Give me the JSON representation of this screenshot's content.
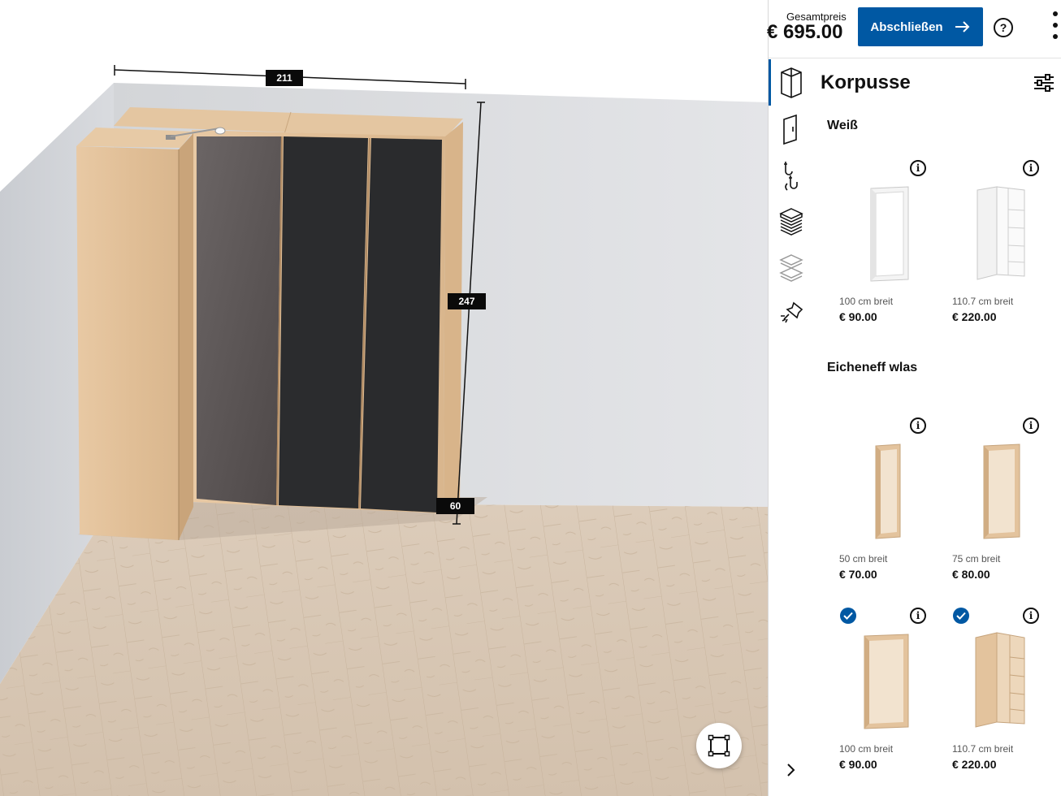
{
  "viewport": {
    "dimensions": {
      "width": "211",
      "height": "247",
      "depth": "60"
    }
  },
  "header": {
    "total_label": "Gesamtpreis",
    "total_price": "€ 695.00",
    "finish_label": "Abschließen",
    "help_icon": "question-circle-icon",
    "more_icon": "more-vertical-icon"
  },
  "nav": {
    "items": [
      {
        "icon": "cabinet-frame-icon",
        "active": true
      },
      {
        "icon": "door-icon",
        "active": false
      },
      {
        "icon": "handle-icon",
        "active": false
      },
      {
        "icon": "shelves-icon",
        "active": false
      },
      {
        "icon": "baskets-icon",
        "active": false
      },
      {
        "icon": "lamp-icon",
        "active": false
      }
    ]
  },
  "section": {
    "title": "Korpusse",
    "filter_icon": "sliders-icon"
  },
  "groups": [
    {
      "title": "Weiß",
      "items": [
        {
          "width": "100 cm breit",
          "price": "€ 90.00",
          "selected": false
        },
        {
          "width": "110.7 cm breit",
          "price": "€ 220.00",
          "selected": false
        }
      ]
    },
    {
      "title": "Eicheneff wlas",
      "items": [
        {
          "width": "50 cm breit",
          "price": "€ 70.00",
          "selected": false
        },
        {
          "width": "75 cm breit",
          "price": "€ 80.00",
          "selected": false
        },
        {
          "width": "100 cm breit",
          "price": "€ 90.00",
          "selected": true
        },
        {
          "width": "110.7 cm breit",
          "price": "€ 220.00",
          "selected": true
        }
      ]
    }
  ],
  "colors": {
    "accent": "#0058a3",
    "oak": "#e3c39d",
    "white_frame": "#f4f4f4",
    "dark_glass": "#2a2b2d"
  }
}
